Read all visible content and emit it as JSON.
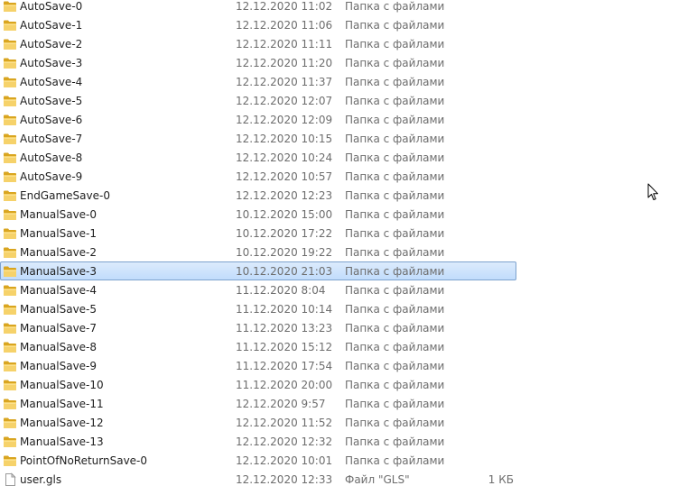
{
  "files": [
    {
      "name": "AutoSave-0",
      "date": "12.12.2020 11:02",
      "type": "Папка с файлами",
      "size": "",
      "icon": "folder-icon"
    },
    {
      "name": "AutoSave-1",
      "date": "12.12.2020 11:06",
      "type": "Папка с файлами",
      "size": "",
      "icon": "folder-icon"
    },
    {
      "name": "AutoSave-2",
      "date": "12.12.2020 11:11",
      "type": "Папка с файлами",
      "size": "",
      "icon": "folder-icon"
    },
    {
      "name": "AutoSave-3",
      "date": "12.12.2020 11:20",
      "type": "Папка с файлами",
      "size": "",
      "icon": "folder-icon"
    },
    {
      "name": "AutoSave-4",
      "date": "12.12.2020 11:37",
      "type": "Папка с файлами",
      "size": "",
      "icon": "folder-icon"
    },
    {
      "name": "AutoSave-5",
      "date": "12.12.2020 12:07",
      "type": "Папка с файлами",
      "size": "",
      "icon": "folder-icon"
    },
    {
      "name": "AutoSave-6",
      "date": "12.12.2020 12:09",
      "type": "Папка с файлами",
      "size": "",
      "icon": "folder-icon"
    },
    {
      "name": "AutoSave-7",
      "date": "12.12.2020 10:15",
      "type": "Папка с файлами",
      "size": "",
      "icon": "folder-icon"
    },
    {
      "name": "AutoSave-8",
      "date": "12.12.2020 10:24",
      "type": "Папка с файлами",
      "size": "",
      "icon": "folder-icon"
    },
    {
      "name": "AutoSave-9",
      "date": "12.12.2020 10:57",
      "type": "Папка с файлами",
      "size": "",
      "icon": "folder-icon"
    },
    {
      "name": "EndGameSave-0",
      "date": "12.12.2020 12:23",
      "type": "Папка с файлами",
      "size": "",
      "icon": "folder-icon"
    },
    {
      "name": "ManualSave-0",
      "date": "10.12.2020 15:00",
      "type": "Папка с файлами",
      "size": "",
      "icon": "folder-icon"
    },
    {
      "name": "ManualSave-1",
      "date": "10.12.2020 17:22",
      "type": "Папка с файлами",
      "size": "",
      "icon": "folder-icon"
    },
    {
      "name": "ManualSave-2",
      "date": "10.12.2020 19:22",
      "type": "Папка с файлами",
      "size": "",
      "icon": "folder-icon"
    },
    {
      "name": "ManualSave-3",
      "date": "10.12.2020 21:03",
      "type": "Папка с файлами",
      "size": "",
      "icon": "folder-icon",
      "selected": true
    },
    {
      "name": "ManualSave-4",
      "date": "11.12.2020 8:04",
      "type": "Папка с файлами",
      "size": "",
      "icon": "folder-icon"
    },
    {
      "name": "ManualSave-5",
      "date": "11.12.2020 10:14",
      "type": "Папка с файлами",
      "size": "",
      "icon": "folder-icon"
    },
    {
      "name": "ManualSave-7",
      "date": "11.12.2020 13:23",
      "type": "Папка с файлами",
      "size": "",
      "icon": "folder-icon"
    },
    {
      "name": "ManualSave-8",
      "date": "11.12.2020 15:12",
      "type": "Папка с файлами",
      "size": "",
      "icon": "folder-icon"
    },
    {
      "name": "ManualSave-9",
      "date": "11.12.2020 17:54",
      "type": "Папка с файлами",
      "size": "",
      "icon": "folder-icon"
    },
    {
      "name": "ManualSave-10",
      "date": "11.12.2020 20:00",
      "type": "Папка с файлами",
      "size": "",
      "icon": "folder-icon"
    },
    {
      "name": "ManualSave-11",
      "date": "12.12.2020 9:57",
      "type": "Папка с файлами",
      "size": "",
      "icon": "folder-icon"
    },
    {
      "name": "ManualSave-12",
      "date": "12.12.2020 11:52",
      "type": "Папка с файлами",
      "size": "",
      "icon": "folder-icon"
    },
    {
      "name": "ManualSave-13",
      "date": "12.12.2020 12:32",
      "type": "Папка с файлами",
      "size": "",
      "icon": "folder-icon"
    },
    {
      "name": "PointOfNoReturnSave-0",
      "date": "12.12.2020 10:01",
      "type": "Папка с файлами",
      "size": "",
      "icon": "folder-icon"
    },
    {
      "name": "user.gls",
      "date": "12.12.2020 12:33",
      "type": "Файл \"GLS\"",
      "size": "1 КБ",
      "icon": "file-icon"
    }
  ],
  "colors": {
    "selection_top": "#dcebfc",
    "selection_bottom": "#c1dcfc",
    "selection_border": "#7da2ce",
    "folder": "#f6d26a",
    "secondary_text": "#6d6d6d"
  },
  "cursor": {
    "icon": "mouse-pointer-icon"
  }
}
